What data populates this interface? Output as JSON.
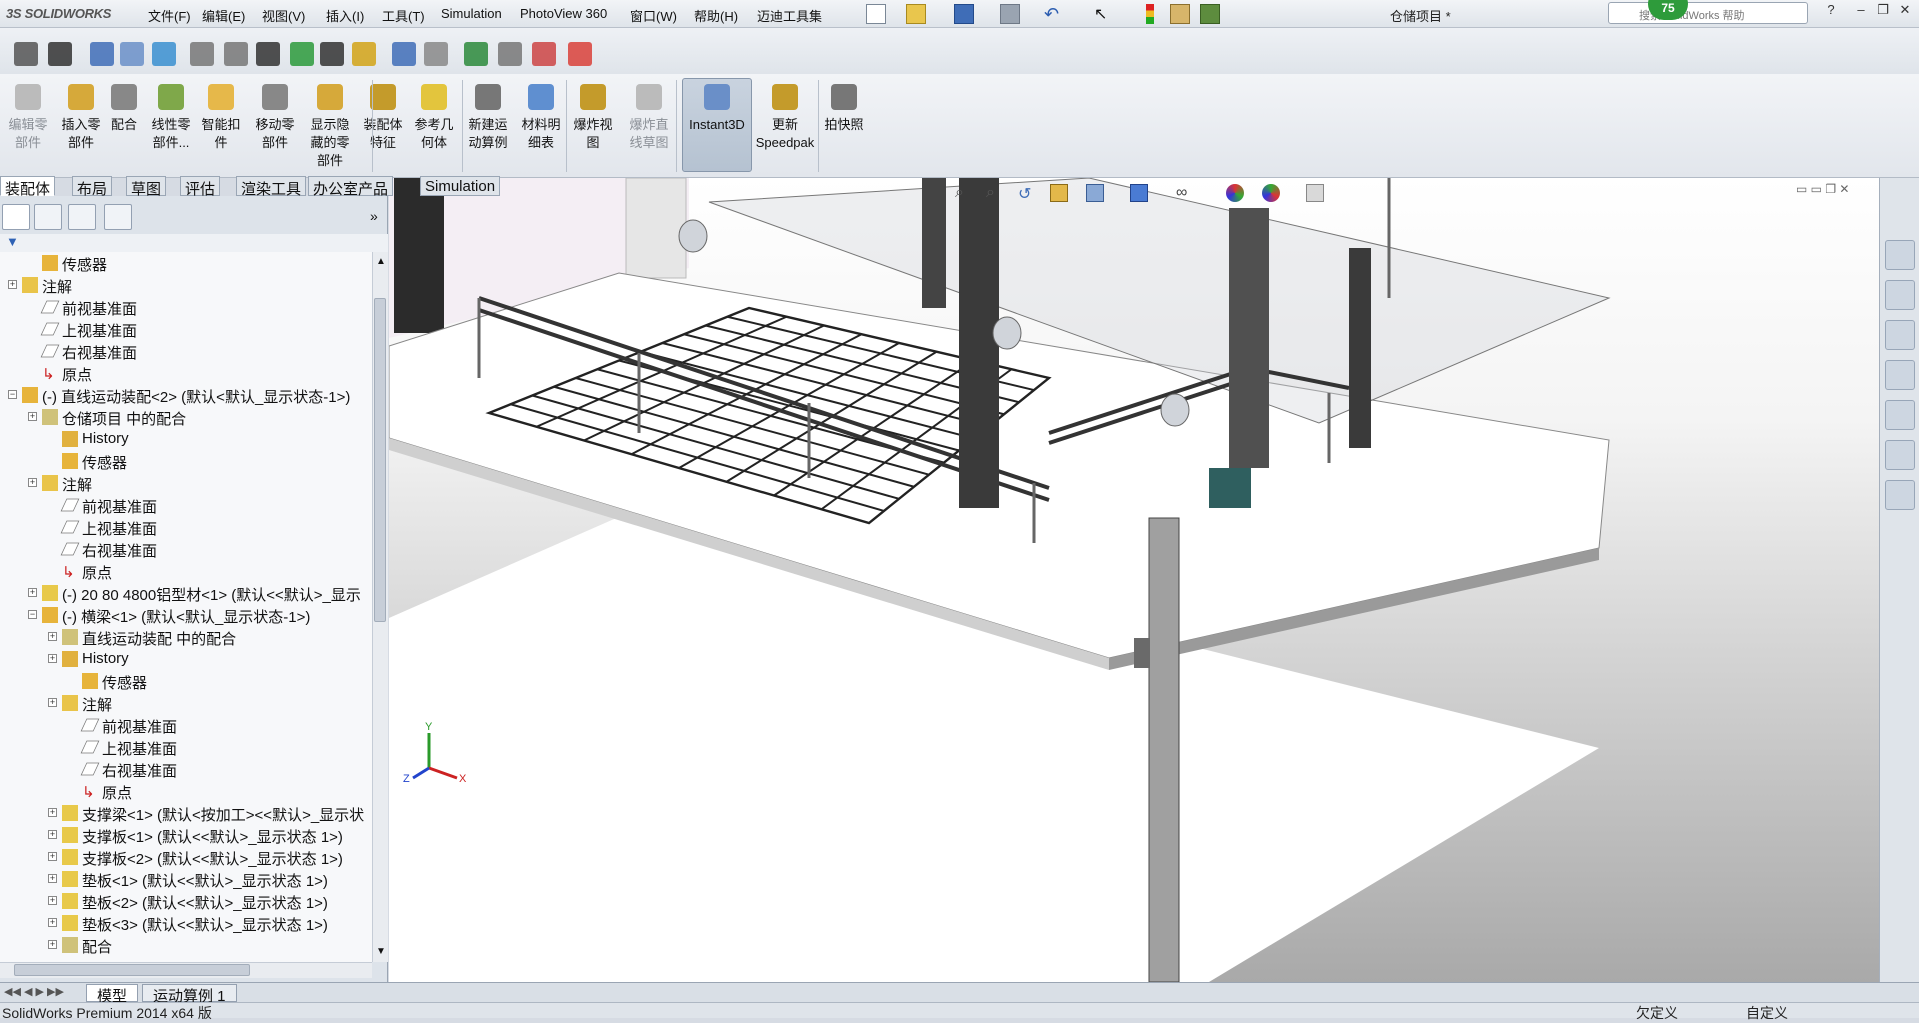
{
  "app": {
    "logo": "SOLIDWORKS",
    "document_title": "仓储项目 *",
    "help_placeholder": "搜索 SolidWorks 帮助",
    "notification_count": "75"
  },
  "menu": [
    "文件(F)",
    "编辑(E)",
    "视图(V)",
    "插入(I)",
    "工具(T)",
    "Simulation",
    "PhotoView 360",
    "窗口(W)",
    "帮助(H)",
    "迈迪工具集"
  ],
  "command_manager": [
    {
      "label": "编辑零部件",
      "line1": "编辑零",
      "line2": "部件",
      "enabled": false
    },
    {
      "label": "插入零部件",
      "line1": "插入零",
      "line2": "部件",
      "enabled": true
    },
    {
      "label": "配合",
      "line1": "配合",
      "line2": "",
      "enabled": true
    },
    {
      "label": "线性零部件",
      "line1": "线性零",
      "line2": "部件...",
      "enabled": true
    },
    {
      "label": "智能扣件",
      "line1": "智能扣",
      "line2": "件",
      "enabled": true
    },
    {
      "label": "移动零部件",
      "line1": "移动零",
      "line2": "部件",
      "enabled": true
    },
    {
      "label": "显示隐藏的零部件",
      "line1": "显示隐",
      "line2": "藏的零",
      "line3": "部件",
      "enabled": true
    },
    {
      "label": "装配体特征",
      "line1": "装配体",
      "line2": "特征",
      "enabled": true
    },
    {
      "label": "参考几何体",
      "line1": "参考几",
      "line2": "何体",
      "enabled": true
    },
    {
      "label": "新建运动算例",
      "line1": "新建运",
      "line2": "动算例",
      "enabled": true
    },
    {
      "label": "材料明细表",
      "line1": "材料明",
      "line2": "细表",
      "enabled": true
    },
    {
      "label": "爆炸视图",
      "line1": "爆炸视",
      "line2": "图",
      "enabled": true
    },
    {
      "label": "爆炸直线草图",
      "line1": "爆炸直",
      "line2": "线草图",
      "enabled": false
    },
    {
      "label": "Instant3D",
      "line1": "Instant3D",
      "line2": "",
      "enabled": true
    },
    {
      "label": "更新Speedpak",
      "line1": "更新",
      "line2": "Speedpak",
      "enabled": true
    },
    {
      "label": "拍快照",
      "line1": "拍快照",
      "line2": "",
      "enabled": true
    }
  ],
  "tabs": [
    "装配体",
    "布局",
    "草图",
    "评估",
    "渲染工具",
    "办公室产品",
    "Simulation"
  ],
  "tree": [
    {
      "indent": 1,
      "exp": "",
      "icon": "sensor",
      "text": "传感器"
    },
    {
      "indent": 0,
      "exp": "+",
      "icon": "annotation",
      "text": "注解"
    },
    {
      "indent": 1,
      "exp": "",
      "icon": "plane",
      "text": "前视基准面"
    },
    {
      "indent": 1,
      "exp": "",
      "icon": "plane",
      "text": "上视基准面"
    },
    {
      "indent": 1,
      "exp": "",
      "icon": "plane",
      "text": "右视基准面"
    },
    {
      "indent": 1,
      "exp": "",
      "icon": "origin",
      "text": "原点"
    },
    {
      "indent": 0,
      "exp": "-",
      "icon": "assembly",
      "text": "(-) 直线运动装配<2> (默认<默认_显示状态-1>)"
    },
    {
      "indent": 1,
      "exp": "+",
      "icon": "mates",
      "text": "仓储项目 中的配合"
    },
    {
      "indent": 2,
      "exp": "",
      "icon": "history",
      "text": "History"
    },
    {
      "indent": 2,
      "exp": "",
      "icon": "sensor",
      "text": "传感器"
    },
    {
      "indent": 1,
      "exp": "+",
      "icon": "annotation",
      "text": "注解"
    },
    {
      "indent": 2,
      "exp": "",
      "icon": "plane",
      "text": "前视基准面"
    },
    {
      "indent": 2,
      "exp": "",
      "icon": "plane",
      "text": "上视基准面"
    },
    {
      "indent": 2,
      "exp": "",
      "icon": "plane",
      "text": "右视基准面"
    },
    {
      "indent": 2,
      "exp": "",
      "icon": "origin",
      "text": "原点"
    },
    {
      "indent": 1,
      "exp": "+",
      "icon": "part",
      "text": "(-) 20 80  4800铝型材<1> (默认<<默认>_显示"
    },
    {
      "indent": 1,
      "exp": "-",
      "icon": "assembly",
      "text": "(-) 横梁<1> (默认<默认_显示状态-1>)"
    },
    {
      "indent": 2,
      "exp": "+",
      "icon": "mates",
      "text": "直线运动装配 中的配合"
    },
    {
      "indent": 2,
      "exp": "+",
      "icon": "history",
      "text": "History"
    },
    {
      "indent": 3,
      "exp": "",
      "icon": "sensor",
      "text": "传感器"
    },
    {
      "indent": 2,
      "exp": "+",
      "icon": "annotation",
      "text": "注解"
    },
    {
      "indent": 3,
      "exp": "",
      "icon": "plane",
      "text": "前视基准面"
    },
    {
      "indent": 3,
      "exp": "",
      "icon": "plane",
      "text": "上视基准面"
    },
    {
      "indent": 3,
      "exp": "",
      "icon": "plane",
      "text": "右视基准面"
    },
    {
      "indent": 3,
      "exp": "",
      "icon": "origin",
      "text": "原点"
    },
    {
      "indent": 2,
      "exp": "+",
      "icon": "part",
      "text": "支撑梁<1> (默认<按加工><<默认>_显示状"
    },
    {
      "indent": 2,
      "exp": "+",
      "icon": "part",
      "text": "支撑板<1> (默认<<默认>_显示状态 1>)"
    },
    {
      "indent": 2,
      "exp": "+",
      "icon": "part",
      "text": "支撑板<2> (默认<<默认>_显示状态 1>)"
    },
    {
      "indent": 2,
      "exp": "+",
      "icon": "part",
      "text": "垫板<1> (默认<<默认>_显示状态 1>)"
    },
    {
      "indent": 2,
      "exp": "+",
      "icon": "part",
      "text": "垫板<2> (默认<<默认>_显示状态 1>)"
    },
    {
      "indent": 2,
      "exp": "+",
      "icon": "part",
      "text": "垫板<3> (默认<<默认>_显示状态 1>)"
    },
    {
      "indent": 2,
      "exp": "+",
      "icon": "mates",
      "text": "配合"
    }
  ],
  "bottom_tabs": [
    "模型",
    "运动算例 1"
  ],
  "status": {
    "left": "SolidWorks Premium 2014 x64 版",
    "right1": "欠定义",
    "right2": "自定义"
  },
  "triad": {
    "x": "X",
    "y": "Y",
    "z": "Z"
  }
}
